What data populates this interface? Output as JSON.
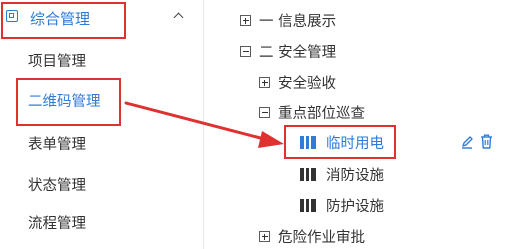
{
  "sidebar": {
    "parent_label": "综合管理",
    "items": [
      {
        "label": "项目管理"
      },
      {
        "label": "二维码管理"
      },
      {
        "label": "表单管理"
      },
      {
        "label": "状态管理"
      },
      {
        "label": "流程管理"
      }
    ],
    "active_index": 1
  },
  "tree": {
    "nodes": [
      {
        "label": "一 信息展示",
        "toggle": "plus"
      },
      {
        "label": "二 安全管理",
        "toggle": "minus"
      },
      {
        "label": "安全验收",
        "toggle": "plus"
      },
      {
        "label": "重点部位巡查",
        "toggle": "minus"
      },
      {
        "label": "临时用电",
        "toggle": "none",
        "selected": true
      },
      {
        "label": "消防设施",
        "toggle": "none"
      },
      {
        "label": "防护设施",
        "toggle": "none"
      },
      {
        "label": "危险作业审批",
        "toggle": "plus"
      }
    ],
    "action_icons": [
      "edit-icon",
      "delete-icon"
    ]
  },
  "colors": {
    "accent": "#2f7bd6",
    "annotation": "#e03131",
    "leaf_icon": "#333333"
  }
}
